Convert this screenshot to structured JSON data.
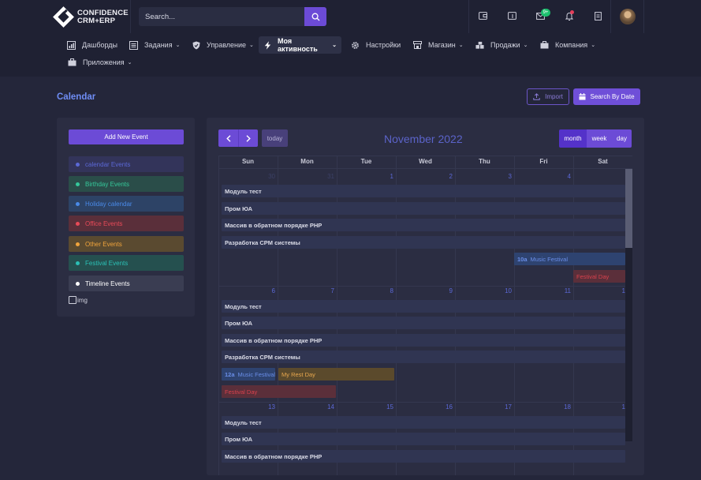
{
  "brand": {
    "line1": "CONFIDENCE",
    "line2": "CRM+ERP"
  },
  "search": {
    "placeholder": "Search..."
  },
  "header": {
    "mail_badge": "9+"
  },
  "nav": [
    {
      "label": "Дашборды",
      "icon": "chart-icon",
      "caret": false
    },
    {
      "label": "Задания",
      "icon": "list-icon",
      "caret": true
    },
    {
      "label": "Управление",
      "icon": "shield-icon",
      "caret": true
    },
    {
      "label": "Моя активность",
      "icon": "bolt-icon",
      "caret": true,
      "active": true
    },
    {
      "label": "Настройки",
      "icon": "gear-icon",
      "caret": false
    },
    {
      "label": "Магазин",
      "icon": "store-icon",
      "caret": true
    },
    {
      "label": "Продажи",
      "icon": "boxes-icon",
      "caret": true
    },
    {
      "label": "Компания",
      "icon": "briefcase-icon",
      "caret": true
    },
    {
      "label": "Приложения",
      "icon": "briefcase-icon",
      "caret": true
    }
  ],
  "page": {
    "title": "Calendar",
    "import_label": "Import",
    "search_by_date_label": "Search By Date"
  },
  "sidebar": {
    "add_event_label": "Add New Event",
    "events": [
      {
        "label": "calendar Events",
        "color": "#5b68d6",
        "bg": "#33345a",
        "dot": "#5b68d6"
      },
      {
        "label": "Birthday Events",
        "color": "#35c89a",
        "bg": "#2a4d49",
        "dot": "#35c89a"
      },
      {
        "label": "Holiday calendar",
        "color": "#4a8ae8",
        "bg": "#2d4366",
        "dot": "#4a8ae8"
      },
      {
        "label": "Office Events",
        "color": "#e84a58",
        "bg": "#5a2f3a",
        "dot": "#e84a58"
      },
      {
        "label": "Other Events",
        "color": "#f0a43c",
        "bg": "#5a4a30",
        "dot": "#f0a43c"
      },
      {
        "label": "Festival Events",
        "color": "#2bc0b5",
        "bg": "#25504f",
        "dot": "#2bc0b5"
      },
      {
        "label": "Timeline Events",
        "color": "#ffffff",
        "bg": "#3a3d52",
        "dot": "#ffffff"
      }
    ],
    "checkbox_label": "img"
  },
  "calendar": {
    "today_label": "today",
    "title": "November 2022",
    "views": [
      "month",
      "week",
      "day"
    ],
    "active_view": "month",
    "weekdays": [
      "Sun",
      "Mon",
      "Tue",
      "Wed",
      "Thu",
      "Fri",
      "Sat"
    ],
    "weeks": [
      {
        "days": [
          "30",
          "31",
          "1",
          "2",
          "3",
          "4",
          ""
        ],
        "dim": [
          true,
          true,
          false,
          false,
          false,
          false,
          false
        ]
      },
      {
        "days": [
          "6",
          "7",
          "8",
          "9",
          "10",
          "11",
          "1"
        ],
        "dim": [
          false,
          false,
          false,
          false,
          false,
          false,
          false
        ]
      },
      {
        "days": [
          "13",
          "14",
          "15",
          "16",
          "17",
          "18",
          "1"
        ],
        "dim": [
          false,
          false,
          false,
          false,
          false,
          false,
          false
        ]
      }
    ],
    "events": {
      "task1": "Модуль тест",
      "task2": "Пром ЮА",
      "task3": "Массив в обратном порядке PHP",
      "task4": "Разработка CPM системы",
      "music_time_1": "10a",
      "music_title_1": "Music Festival",
      "fest_1": "Festival Day",
      "music_time_2": "12a",
      "music_title_2": "Music Festival",
      "rest_day": "My Rest Day",
      "fest_2": "Festival Day"
    }
  }
}
